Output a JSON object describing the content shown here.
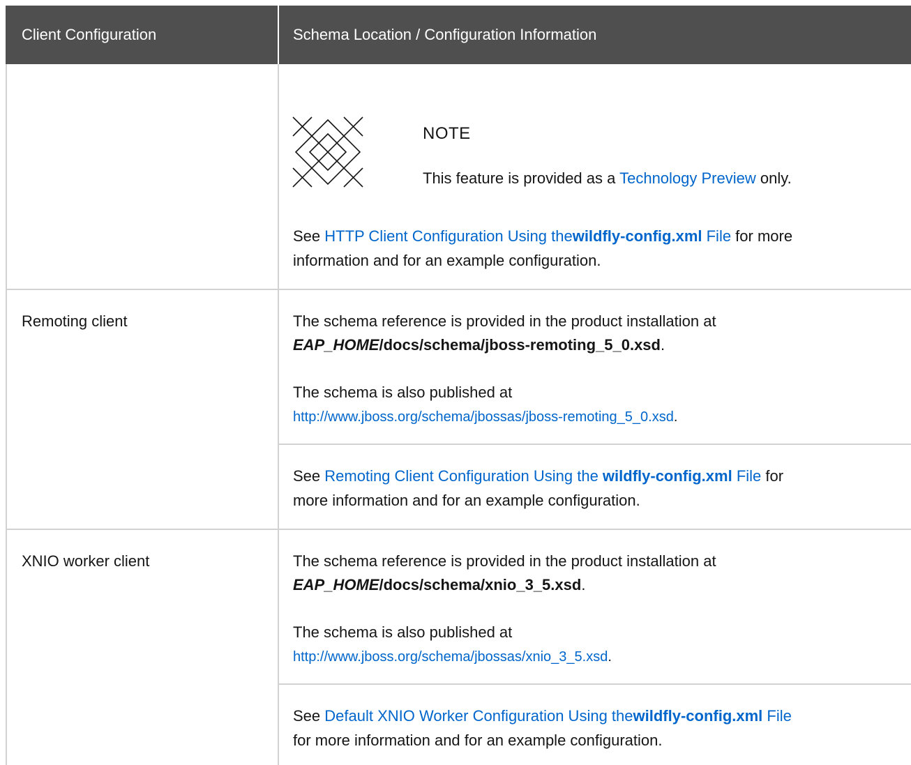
{
  "table": {
    "headers": [
      "Client Configuration",
      "Schema Location / Configuration Information"
    ],
    "http_row": {
      "note_title": "NOTE",
      "note_prefix": "This feature is provided as a ",
      "note_link": "Technology Preview",
      "note_suffix": " only.",
      "see_prefix": "See ",
      "see_link_pre": "HTTP Client Configuration Using the",
      "see_link_code": "wildfly-config.xml",
      "see_link_post": " File",
      "see_suffix_1": " for more",
      "see_line_2": "information and for an example configuration."
    },
    "remoting_row": {
      "label": "Remoting client",
      "ref_line_1": "The schema reference is provided in the product installation at",
      "ref_code_em": "EAP_HOME",
      "ref_code_rest": "/docs/schema/jboss-remoting_5_0.xsd",
      "ref_end": ".",
      "pub_line_1": "The schema is also published at",
      "pub_link": "http://www.jboss.org/schema/jbossas/jboss-remoting_5_0.xsd",
      "pub_end": ".",
      "see_prefix": "See ",
      "see_link_pre": "Remoting Client Configuration Using the ",
      "see_link_code": "wildfly-config.xml",
      "see_link_post": " File",
      "see_suffix_1": " for",
      "see_line_2": "more information and for an example configuration."
    },
    "xnio_row": {
      "label": "XNIO worker client",
      "ref_line_1": "The schema reference is provided in the product installation at",
      "ref_code_em": "EAP_HOME",
      "ref_code_rest": "/docs/schema/xnio_3_5.xsd",
      "ref_end": ".",
      "pub_line_1": "The schema is also published at",
      "pub_link": "http://www.jboss.org/schema/jbossas/xnio_3_5.xsd",
      "pub_end": ".",
      "see_prefix": "See ",
      "see_link_pre": "Default XNIO Worker Configuration Using the",
      "see_link_code": "wildfly-config.xml",
      "see_link_post": " File",
      "see_line_2": "for more information and for an example configuration."
    }
  },
  "colors": {
    "header_bg": "#4f4f4f",
    "link": "#0066cc",
    "border": "#d2d2d2"
  }
}
